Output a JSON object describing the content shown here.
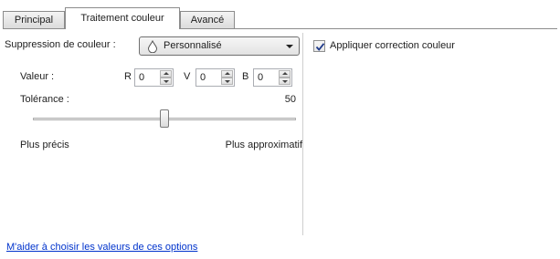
{
  "tabs": [
    {
      "label": "Principal",
      "active": false
    },
    {
      "label": "Traitement couleur",
      "active": true
    },
    {
      "label": "Avancé",
      "active": false
    }
  ],
  "color_dropout": {
    "label": "Suppression de couleur :",
    "selected": "Personnalisé",
    "icon": "droplet-icon"
  },
  "value_row": {
    "label": "Valeur :",
    "r": {
      "label": "R",
      "value": "0"
    },
    "v": {
      "label": "V",
      "value": "0"
    },
    "b": {
      "label": "B",
      "value": "0"
    }
  },
  "tolerance": {
    "label": "Tolérance :",
    "value": "50",
    "fraction": 0.5,
    "min_label": "Plus précis",
    "max_label": "Plus approximatif"
  },
  "color_correction": {
    "label": "Appliquer correction couleur",
    "checked": true
  },
  "help_link": "M'aider à choisir les valeurs de ces options",
  "colors": {
    "link": "#0033cc",
    "check": "#1f3a8a"
  }
}
